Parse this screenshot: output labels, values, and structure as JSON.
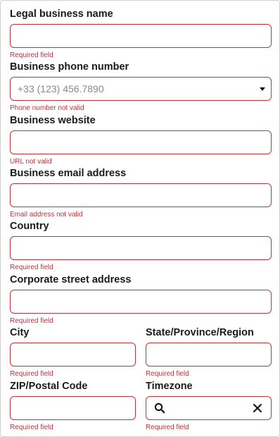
{
  "form": {
    "legal_name": {
      "label": "Legal business name",
      "value": "",
      "error": "Required field"
    },
    "phone": {
      "label": "Business phone number",
      "placeholder": "+33 (123) 456.7890",
      "error": "Phone number not valid"
    },
    "website": {
      "label": "Business website",
      "value": "",
      "error": "URL not valid"
    },
    "email": {
      "label": "Business email address",
      "value": "",
      "error": "Email address not valid"
    },
    "country": {
      "label": "Country",
      "value": "",
      "error": "Required field"
    },
    "street": {
      "label": "Corporate street address",
      "value": "",
      "error": "Required field"
    },
    "city": {
      "label": "City",
      "value": "",
      "error": "Required field"
    },
    "state": {
      "label": "State/Province/Region",
      "value": "",
      "error": "Required field"
    },
    "zip": {
      "label": "ZIP/Postal Code",
      "value": "",
      "error": "Required field"
    },
    "timezone": {
      "label": "Timezone",
      "value": "",
      "error": "Required field"
    }
  },
  "icons": {
    "phone_dropdown": "chevron-down-icon",
    "timezone_search": "search-icon",
    "timezone_clear": "close-icon"
  },
  "colors": {
    "error": "#c0313b",
    "label": "#1a1a1a",
    "placeholder": "#8a8a8a"
  }
}
